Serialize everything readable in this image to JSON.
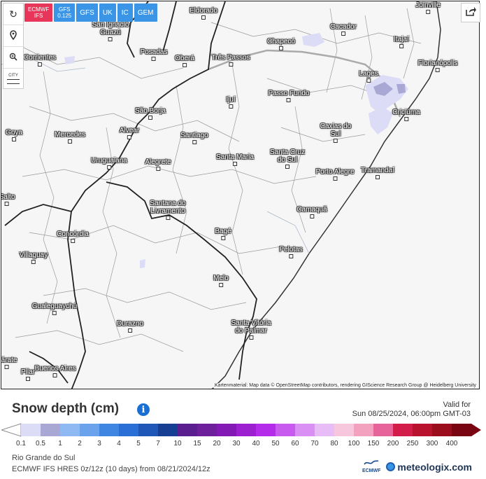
{
  "toolbar": {
    "model_buttons": [
      {
        "label": "ECMWF IFS",
        "active": true
      },
      {
        "label": "GFS 0.125",
        "active": false
      },
      {
        "label": "GFS",
        "active": false
      },
      {
        "label": "UK",
        "active": false
      },
      {
        "label": "IC",
        "active": false
      },
      {
        "label": "GEM",
        "active": false
      }
    ],
    "city_tool_label": "CITY"
  },
  "map": {
    "attribution": "Kartenmaterial: Map data © OpenStreetMap contributors, rendering GIScience Research Group @ Heidelberg University",
    "cities": [
      {
        "name": "Joinville"
      },
      {
        "name": "Eldorado"
      },
      {
        "name": "San Ignacio Guazú"
      },
      {
        "name": "Cacador"
      },
      {
        "name": "Corrientes"
      },
      {
        "name": "Posadas"
      },
      {
        "name": "Oberá"
      },
      {
        "name": "Chapecó"
      },
      {
        "name": "Itajaí"
      },
      {
        "name": "Três Passos"
      },
      {
        "name": "Florianópolis"
      },
      {
        "name": "Lages"
      },
      {
        "name": "Passo Fundo"
      },
      {
        "name": "Ijuí"
      },
      {
        "name": "Criciúma"
      },
      {
        "name": "São Borja"
      },
      {
        "name": "Caxias do Sul"
      },
      {
        "name": "Alvear"
      },
      {
        "name": "Goya"
      },
      {
        "name": "Mercedes"
      },
      {
        "name": "Santiago"
      },
      {
        "name": "Santa Cruz do Sul"
      },
      {
        "name": "Santa Maria"
      },
      {
        "name": "Uruguaiana"
      },
      {
        "name": "Alegrete"
      },
      {
        "name": "Porto Alegre"
      },
      {
        "name": "Tramandaí"
      },
      {
        "name": "Salto"
      },
      {
        "name": "Santana do Livramento"
      },
      {
        "name": "Camaquã"
      },
      {
        "name": "Bagé"
      },
      {
        "name": "Concórdia"
      },
      {
        "name": "Pelotas"
      },
      {
        "name": "Villaguay"
      },
      {
        "name": "Melo"
      },
      {
        "name": "Gualeguaychú"
      },
      {
        "name": "Durazno"
      },
      {
        "name": "Santa Vitória do Palmar"
      },
      {
        "name": "Zárate"
      },
      {
        "name": "Buenos Aires"
      },
      {
        "name": "Pilar"
      }
    ]
  },
  "legend": {
    "title": "Snow depth (cm)",
    "valid_label": "Valid for",
    "valid_time": "Sun 08/25/2024, 06:00pm GMT-03",
    "steps": [
      {
        "value": "0.1",
        "color": "#dcdcf7"
      },
      {
        "value": "0.5",
        "color": "#a9a8d4"
      },
      {
        "value": "1",
        "color": "#8fb9f2"
      },
      {
        "value": "2",
        "color": "#6aa2ec"
      },
      {
        "value": "3",
        "color": "#3f86e2"
      },
      {
        "value": "4",
        "color": "#2a6fd6"
      },
      {
        "value": "5",
        "color": "#1f57b9"
      },
      {
        "value": "7",
        "color": "#163f93"
      },
      {
        "value": "10",
        "color": "#5a1e8f"
      },
      {
        "value": "15",
        "color": "#6d1f9c"
      },
      {
        "value": "20",
        "color": "#8219b5"
      },
      {
        "value": "30",
        "color": "#9c1fd0"
      },
      {
        "value": "40",
        "color": "#b52bea"
      },
      {
        "value": "50",
        "color": "#c85af0"
      },
      {
        "value": "60",
        "color": "#d98ff4"
      },
      {
        "value": "70",
        "color": "#e8bdf7"
      },
      {
        "value": "80",
        "color": "#f6c7dd"
      },
      {
        "value": "100",
        "color": "#f2a1bf"
      },
      {
        "value": "150",
        "color": "#e6649a"
      },
      {
        "value": "200",
        "color": "#d21d4b"
      },
      {
        "value": "250",
        "color": "#b8122e"
      },
      {
        "value": "300",
        "color": "#9b0d1d"
      },
      {
        "value": "400",
        "color": "#7a0512"
      }
    ]
  },
  "footer": {
    "region": "Rio Grande do Sul",
    "model_run": "ECMWF IFS HRES 0z/12z (10 days) from 08/21/2024/12z",
    "ecmwf_logo": "ECMWF",
    "brand": "meteologix.com"
  }
}
